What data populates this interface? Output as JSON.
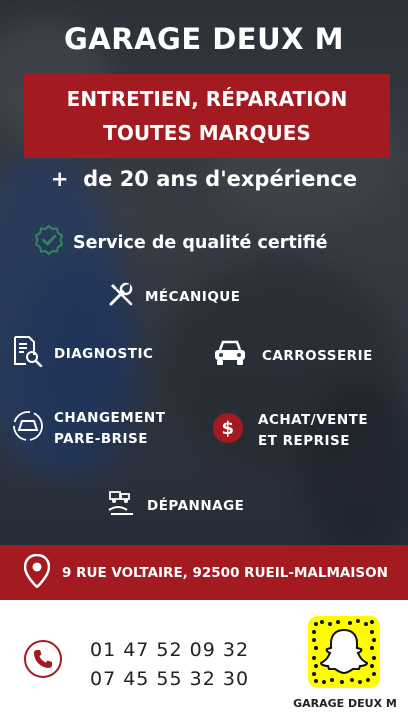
{
  "header": {
    "title": "GARAGE DEUX M"
  },
  "banner": {
    "line1": "ENTRETIEN, RÉPARATION",
    "line2": "TOUTES MARQUES"
  },
  "experience": {
    "plus": "+",
    "text": "de 20 ans d'expérience"
  },
  "quality": {
    "text": "Service de qualité certifié",
    "icon": "verified-badge-icon"
  },
  "services": {
    "mecanique": {
      "label": "MÉCANIQUE",
      "icon": "wrench-screwdriver-icon"
    },
    "diagnostic": {
      "label": "DIAGNOSTIC",
      "icon": "document-search-icon"
    },
    "carrosserie": {
      "label": "CARROSSERIE",
      "icon": "car-icon"
    },
    "parebrise": {
      "line1": "CHANGEMENT",
      "line2": "PARE-BRISE",
      "icon": "windshield-icon"
    },
    "achat": {
      "line1": "ACHAT/VENTE",
      "line2": "ET REPRISE",
      "icon": "dollar-icon"
    },
    "depannage": {
      "label": "DÉPANNAGE",
      "icon": "tow-truck-icon"
    }
  },
  "address": {
    "text": "9 RUE VOLTAIRE, 92500 RUEIL-MALMAISON",
    "icon": "map-pin-icon"
  },
  "contact": {
    "phone1": "01 47 52 09 32",
    "phone2": "07 45 55 32 30",
    "icon": "phone-icon"
  },
  "snapchat": {
    "label": "GARAGE DEUX M",
    "icon": "snapchat-code-icon"
  },
  "colors": {
    "accent": "#a31b21",
    "text": "#ffffff",
    "snap": "#fffc00"
  }
}
